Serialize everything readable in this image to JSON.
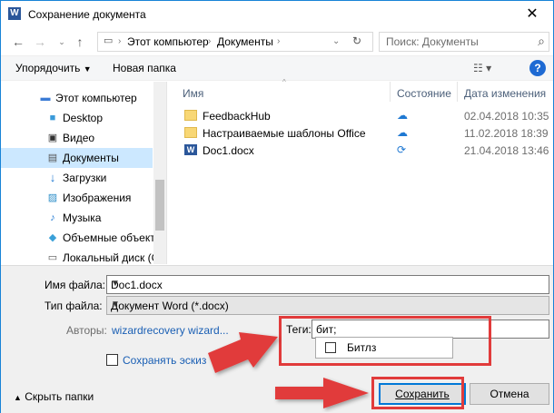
{
  "window": {
    "title": "Сохранение документа",
    "app_icon": "word-icon",
    "close_glyph": "✕"
  },
  "nav": {
    "back_icon": "arrow-left-icon",
    "forward_icon": "arrow-right-icon",
    "up_icon": "arrow-up-icon",
    "breadcrumb": [
      "Этот компьютер",
      "Документы"
    ],
    "search_placeholder": "Поиск: Документы"
  },
  "toolbar": {
    "organize": "Упорядочить",
    "new_folder": "Новая папка"
  },
  "sidebar": {
    "items": [
      {
        "label": "Этот компьютер",
        "icon": "computer-icon"
      },
      {
        "label": "Desktop",
        "icon": "desktop-icon"
      },
      {
        "label": "Видео",
        "icon": "video-icon"
      },
      {
        "label": "Документы",
        "icon": "documents-icon",
        "selected": true
      },
      {
        "label": "Загрузки",
        "icon": "download-icon"
      },
      {
        "label": "Изображения",
        "icon": "pictures-icon"
      },
      {
        "label": "Музыка",
        "icon": "music-icon"
      },
      {
        "label": "Объемные объекты",
        "icon": "3d-objects-icon"
      },
      {
        "label": "Локальный диск (C:",
        "icon": "disk-icon"
      }
    ]
  },
  "table": {
    "columns": [
      "Имя",
      "Состояние",
      "Дата изменения"
    ],
    "rows": [
      {
        "name": "FeedbackHub",
        "type": "folder",
        "status": "cloud",
        "date": "02.04.2018 10:35"
      },
      {
        "name": "Настраиваемые шаблоны Office",
        "type": "folder",
        "status": "cloud",
        "date": "11.02.2018 18:39"
      },
      {
        "name": "Doc1.docx",
        "type": "word",
        "status": "sync",
        "date": "21.04.2018 13:46"
      }
    ]
  },
  "form": {
    "filename_label": "Имя файла:",
    "filename_value": "Doc1.docx",
    "filetype_label": "Тип файла:",
    "filetype_value": "Документ Word (*.docx)",
    "authors_label": "Авторы:",
    "authors_value": "wizardrecovery wizard...",
    "tags_label": "Теги:",
    "tags_value": "бит;",
    "tag_suggestion": "Битлз",
    "save_thumbnail_label": "Сохранять эскиз",
    "hide_folders": "Скрыть папки",
    "save_button": "Сохранить",
    "cancel_button": "Отмена"
  },
  "colors": {
    "accent": "#0078d7",
    "selection": "#cce8ff",
    "annotation": "#e13b3b"
  }
}
